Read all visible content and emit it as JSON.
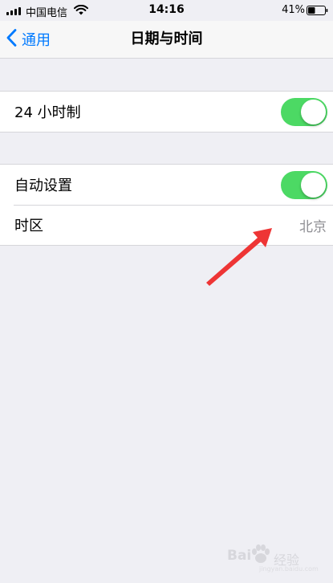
{
  "status_bar": {
    "carrier": "中国电信",
    "time": "14:16",
    "battery": "41%"
  },
  "nav": {
    "back_label": "通用",
    "title": "日期与时间"
  },
  "settings": {
    "hour24": {
      "label": "24 小时制",
      "on": true
    },
    "auto_set": {
      "label": "自动设置",
      "on": true
    },
    "timezone": {
      "label": "时区",
      "value": "北京"
    }
  },
  "watermark": {
    "brand": "Bai",
    "brand_tail": "经验",
    "url": "jingyan.baidu.com"
  },
  "colors": {
    "accent": "#007aff",
    "toggle_on": "#4cd964",
    "annotation": "#ee3535",
    "background": "#efeff4"
  },
  "icons": [
    "signal-icon",
    "wifi-icon",
    "battery-icon",
    "chevron-left-icon",
    "arrow-annotation-icon"
  ]
}
